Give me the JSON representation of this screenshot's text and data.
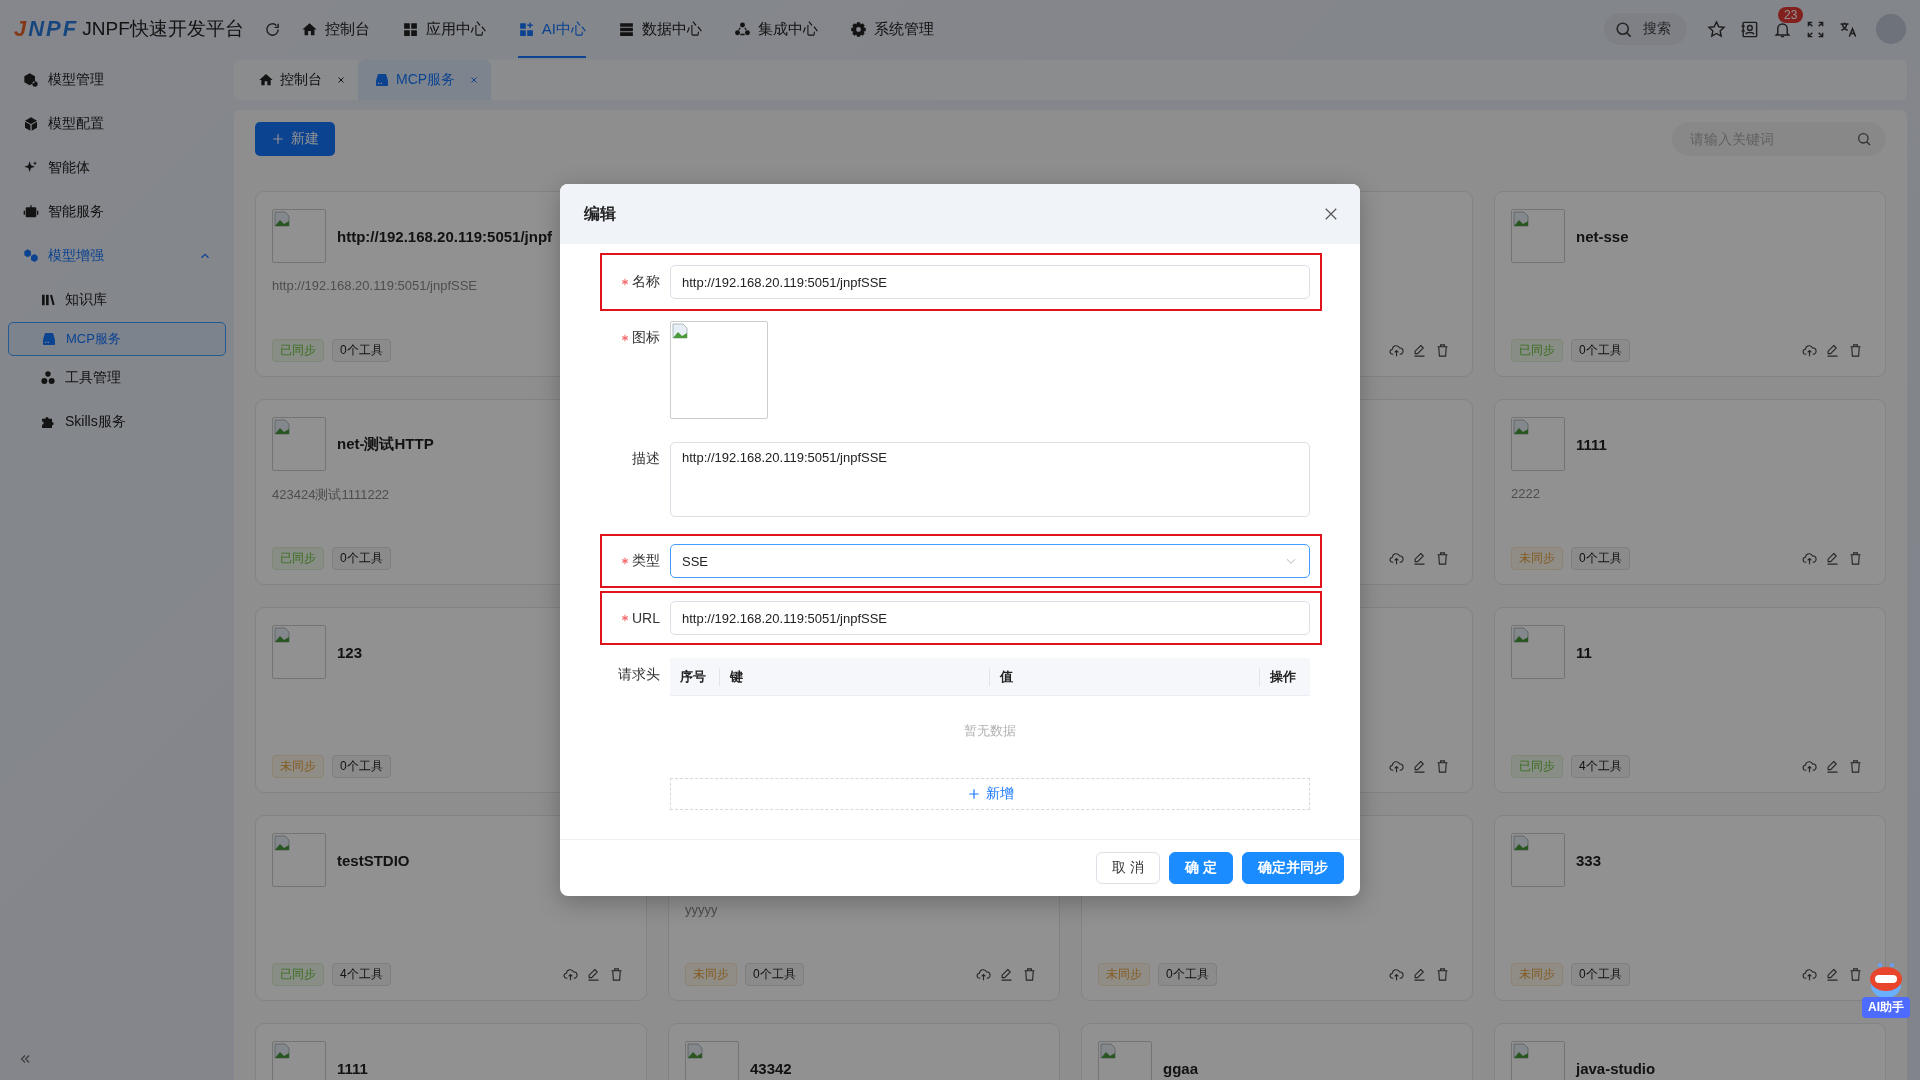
{
  "app": {
    "logo": "JNPF",
    "title": "JNPF快速开发平台"
  },
  "nav": [
    {
      "label": "控制台",
      "kind": "home",
      "selected": false
    },
    {
      "label": "应用中心",
      "kind": "apps",
      "selected": false
    },
    {
      "label": "AI中心",
      "kind": "ai",
      "selected": true
    },
    {
      "label": "数据中心",
      "kind": "data",
      "selected": false
    },
    {
      "label": "集成中心",
      "kind": "integration",
      "selected": false
    },
    {
      "label": "系统管理",
      "kind": "settings",
      "selected": false
    }
  ],
  "header_tools": {
    "search_label": "搜索",
    "notification_count": "23"
  },
  "sidebar": [
    {
      "label": "模型管理",
      "kind": "models",
      "selected": false
    },
    {
      "label": "模型配置",
      "kind": "cube",
      "selected": false
    },
    {
      "label": "智能体",
      "kind": "agent",
      "selected": false
    },
    {
      "label": "智能服务",
      "kind": "service",
      "selected": false
    },
    {
      "label": "模型增强",
      "kind": "enhance",
      "expanded": true,
      "children": [
        {
          "label": "知识库",
          "kind": "library",
          "selected": false
        },
        {
          "label": "MCP服务",
          "kind": "mcp",
          "selected": true
        },
        {
          "label": "工具管理",
          "kind": "tools",
          "selected": false
        },
        {
          "label": "Skills服务",
          "kind": "puzzle",
          "selected": false
        }
      ]
    }
  ],
  "page_tabs": [
    {
      "label": "控制台",
      "kind": "home",
      "selected": false
    },
    {
      "label": "MCP服务",
      "kind": "mcp",
      "selected": true
    }
  ],
  "toolbar": {
    "new_button": "新建",
    "search_placeholder": "请输入关键词"
  },
  "card_columns": [
    [
      {
        "image": true,
        "title": "http://192.168.20.119:5051/jnpf",
        "desc": "http://192.168.20.119:5051/jnpfSSE",
        "sync": {
          "label": "已同步",
          "synced": true
        },
        "tools": "0个工具"
      },
      {
        "image": true,
        "title": "net-测试HTTP",
        "desc": "423424测试1111222",
        "sync": {
          "label": "已同步",
          "synced": true
        },
        "tools": "0个工具"
      },
      {
        "image": true,
        "title": "123",
        "sync": {
          "label": "未同步",
          "synced": false
        },
        "tools": "0个工具"
      },
      {
        "image": true,
        "title": "testSTDIO",
        "sync": {
          "label": "已同步",
          "synced": true
        },
        "tools": "4个工具",
        "actions": true
      },
      {
        "image": true,
        "title": "1111"
      }
    ],
    [
      {
        "desc": "yyyyy",
        "sync": {
          "label": "未同步",
          "synced": false
        },
        "tools": "0个工具",
        "actions": true
      },
      {
        "image": true,
        "title": "43342"
      }
    ],
    [
      {
        "actions": true
      },
      {
        "actions": true
      },
      {
        "actions": true
      },
      {
        "sync": {
          "label": "未同步",
          "synced": false
        },
        "tools": "0个工具",
        "actions": true
      },
      {
        "image": true,
        "title": "ggaa"
      }
    ],
    [
      {
        "image": true,
        "title": "net-sse",
        "sync": {
          "label": "已同步",
          "synced": true
        },
        "tools": "0个工具",
        "actions": true
      },
      {
        "image": true,
        "title": "1111",
        "desc": "2222",
        "sync": {
          "label": "未同步",
          "synced": false
        },
        "tools": "0个工具",
        "actions": true
      },
      {
        "image": true,
        "title": "11",
        "sync": {
          "label": "已同步",
          "synced": true
        },
        "tools": "4个工具",
        "actions": true
      },
      {
        "image": true,
        "title": "333",
        "sync": {
          "label": "未同步",
          "synced": false
        },
        "tools": "0个工具",
        "actions": true
      },
      {
        "image": true,
        "title": "java-studio"
      }
    ]
  ],
  "dialog": {
    "title": "编辑",
    "fields": [
      {
        "kind": "text",
        "label": "名称",
        "required": true,
        "highlighted": true,
        "value": "http://192.168.20.119:5051/jnpfSSE"
      },
      {
        "kind": "image",
        "label": "图标",
        "required": true,
        "highlighted": false
      },
      {
        "kind": "textarea",
        "label": "描述",
        "required": false,
        "highlighted": false,
        "value": "http://192.168.20.119:5051/jnpfSSE"
      },
      {
        "kind": "select",
        "label": "类型",
        "required": true,
        "highlighted": true,
        "value": "SSE"
      },
      {
        "kind": "text",
        "label": "URL",
        "required": true,
        "highlighted": true,
        "value": "http://192.168.20.119:5051/jnpfSSE"
      },
      {
        "kind": "table",
        "label": "请求头",
        "required": false,
        "highlighted": false,
        "columns": [
          "序号",
          "键",
          "值",
          "操作"
        ],
        "empty_text": "暂无数据",
        "add_button": "新增"
      }
    ],
    "buttons": [
      {
        "label": "取 消",
        "kind": "default"
      },
      {
        "label": "确 定",
        "kind": "primary"
      },
      {
        "label": "确定并同步",
        "kind": "primary"
      }
    ]
  },
  "assistant": {
    "label": "AI助手"
  }
}
